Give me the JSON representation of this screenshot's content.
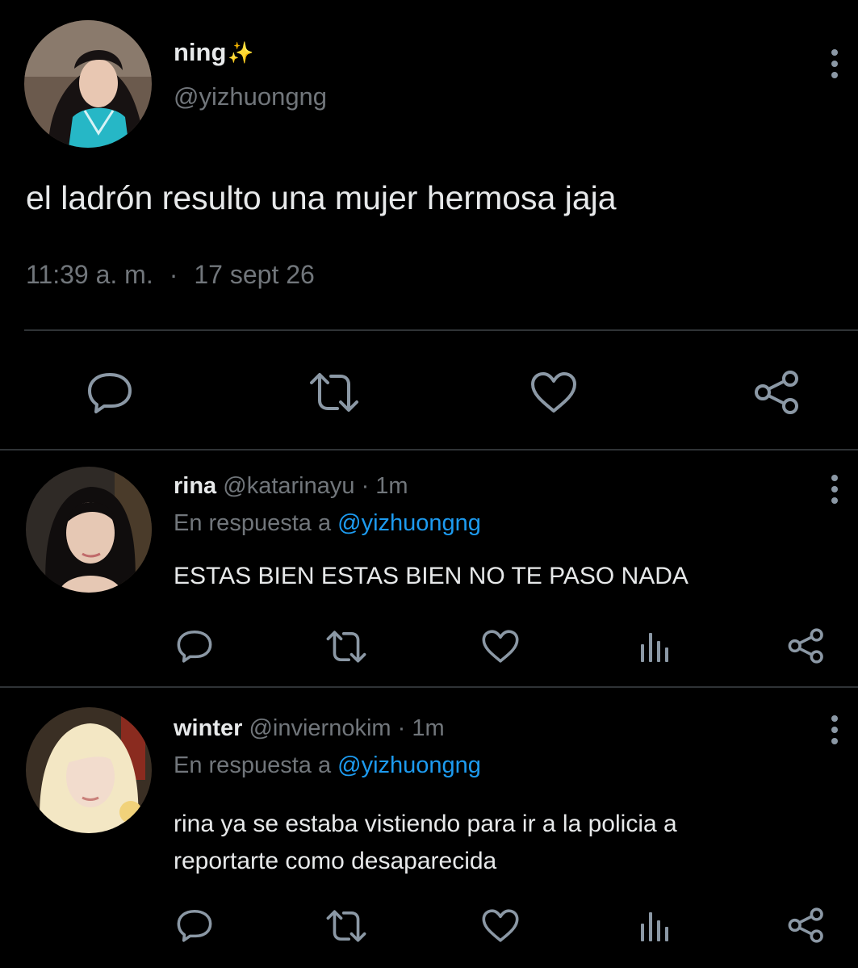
{
  "main_tweet": {
    "display_name": "ning",
    "sparkle": "✨",
    "handle": "@yizhuongng",
    "text": "el ladrón resulto una mujer hermosa jaja",
    "time": "11:39 a. m.",
    "dot": "·",
    "date": "17 sept 26",
    "avatar_colors": {
      "bg": "#6b5a4d",
      "skin": "#e8c7b2",
      "hair": "#171212",
      "top": "#26b7c6"
    },
    "actions": [
      {
        "name": "reply-icon"
      },
      {
        "name": "retweet-icon"
      },
      {
        "name": "like-icon"
      },
      {
        "name": "share-icon"
      }
    ]
  },
  "replies": [
    {
      "display_name": "rina",
      "handle": "@katarinayu",
      "sep": "·",
      "time": "1m",
      "reply_prefix": "En respuesta a",
      "reply_to": "@yizhuongng",
      "text": "ESTAS BIEN ESTAS BIEN NO TE PASO NADA",
      "avatar_colors": {
        "bg": "#2f2a26",
        "skin": "#e6c8b4",
        "hair": "#100d0d"
      }
    },
    {
      "display_name": "winter",
      "handle": "@inviernokim",
      "sep": "·",
      "time": "1m",
      "reply_prefix": "En respuesta a",
      "reply_to": "@yizhuongng",
      "text_line1": "rina ya se estaba vistiendo para ir a la policia a",
      "text_line2": "reportarte como desaparecida",
      "avatar_colors": {
        "bg": "#3a2f24",
        "skin": "#f2dccd",
        "hair": "#f3e7c4"
      }
    }
  ],
  "colors": {
    "background": "#000000",
    "text": "#e7e9ea",
    "muted": "#71767b",
    "link": "#1d9bf0",
    "divider": "#2f3336",
    "icon": "#8b98a5"
  }
}
